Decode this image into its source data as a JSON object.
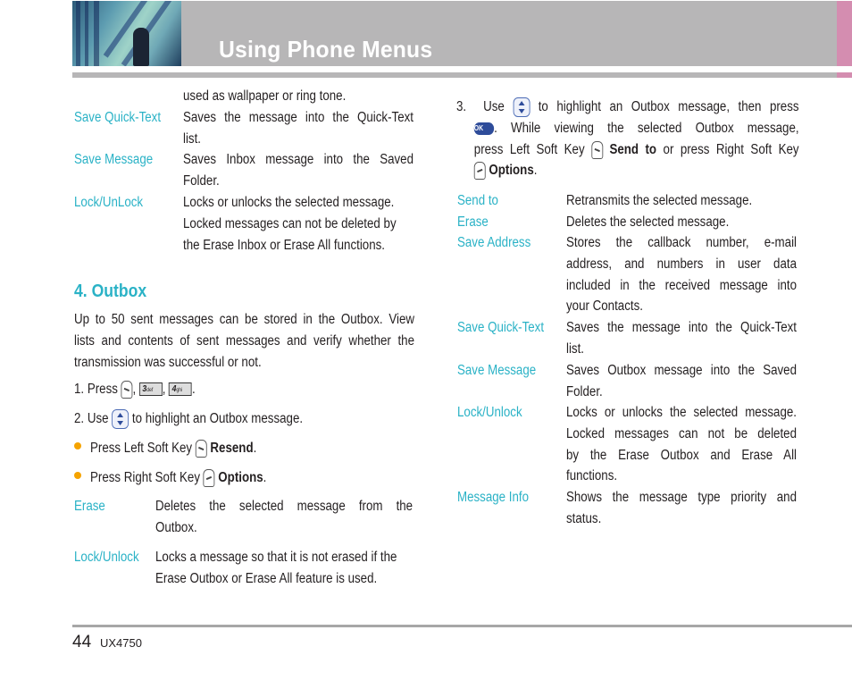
{
  "header": {
    "title": "Using Phone Menus",
    "colors": {
      "bar": "#b7b6b7",
      "accent_pink": "#d48db0",
      "term_cyan": "#2ab2c6",
      "bullet_orange": "#f5a300"
    }
  },
  "left_column": {
    "continued_line": "used as wallpaper or ring tone.",
    "inbox_options": [
      {
        "term": "Save Quick-Text",
        "lines": [
          "Saves the message into the Quick-Text",
          "list."
        ]
      },
      {
        "term": "Save Message",
        "lines": [
          "Saves Inbox message into the Saved",
          "Folder."
        ]
      },
      {
        "term": "Lock/UnLock",
        "lines": [
          "Locks or unlocks the selected message.",
          "Locked messages can not be deleted by",
          "the Erase Inbox or Erase All functions."
        ]
      }
    ],
    "section": {
      "title": "4. Outbox",
      "intro_lines": [
        "Up to 50 sent messages can be stored in the Outbox. View",
        "lists and contents of sent messages and verify whether the",
        "transmission was successful or not."
      ],
      "step1": {
        "prefix": "1.  Press",
        "sep1": ",",
        "sep2": ",",
        "end": ".",
        "keys": [
          {
            "icon": "left-soft-key-icon"
          },
          {
            "icon": "key-3-icon",
            "digit": "3",
            "letters": "def"
          },
          {
            "icon": "key-4-icon",
            "digit": "4",
            "letters": "ghi"
          }
        ]
      },
      "step2": {
        "prefix": "2.  Use",
        "suffix": "to highlight an Outbox message.",
        "icon": "nav-key-icon"
      },
      "bullets": [
        {
          "prefix": "Press Left Soft Key",
          "icon": "left-soft-key-icon",
          "bold": "Resend",
          "end": "."
        },
        {
          "prefix": "Press Right Soft Key",
          "icon": "right-soft-key-icon",
          "bold": "Options",
          "end": "."
        }
      ],
      "options": [
        {
          "term": "Erase",
          "lines": [
            "Deletes the selected message from the",
            "Outbox."
          ]
        },
        {
          "term": "Lock/Unlock",
          "lines": [
            "Locks a message so that it is not erased if the",
            "Erase Outbox or Erase All feature is used."
          ]
        }
      ]
    }
  },
  "right_column": {
    "step3": {
      "num": "3.",
      "use": "Use",
      "line1_rest": "to highlight an Outbox message, then press",
      "ok_label": "OK",
      "line2_rest": ". While viewing the selected Outbox message,",
      "line3_prefix": "press Left Soft Key",
      "send_to": "Send to",
      "line3_mid": "or press Right Soft Key",
      "options_bold": "Options",
      "end": "."
    },
    "options": [
      {
        "term": "Send to",
        "lines": [
          "Retransmits the selected message."
        ]
      },
      {
        "term": "Erase",
        "lines": [
          "Deletes the selected message."
        ]
      },
      {
        "term": "Save Address",
        "lines": [
          "Stores the callback number, e-mail",
          "address, and numbers in user data",
          "included in the received message into",
          "your Contacts."
        ]
      },
      {
        "term": "Save Quick-Text",
        "lines": [
          "Saves the message into the Quick-Text",
          "list."
        ]
      },
      {
        "term": "Save Message",
        "lines": [
          "Saves Outbox message into the Saved",
          "Folder."
        ]
      },
      {
        "term": "Lock/Unlock",
        "lines": [
          "Locks or unlocks the selected message.",
          "Locked messages can not be deleted",
          "by the Erase Outbox and Erase All",
          "functions."
        ]
      },
      {
        "term": "Message Info",
        "lines": [
          "Shows the message type priority and",
          "status."
        ]
      }
    ]
  },
  "footer": {
    "page_number": "44",
    "model": "UX4750"
  }
}
